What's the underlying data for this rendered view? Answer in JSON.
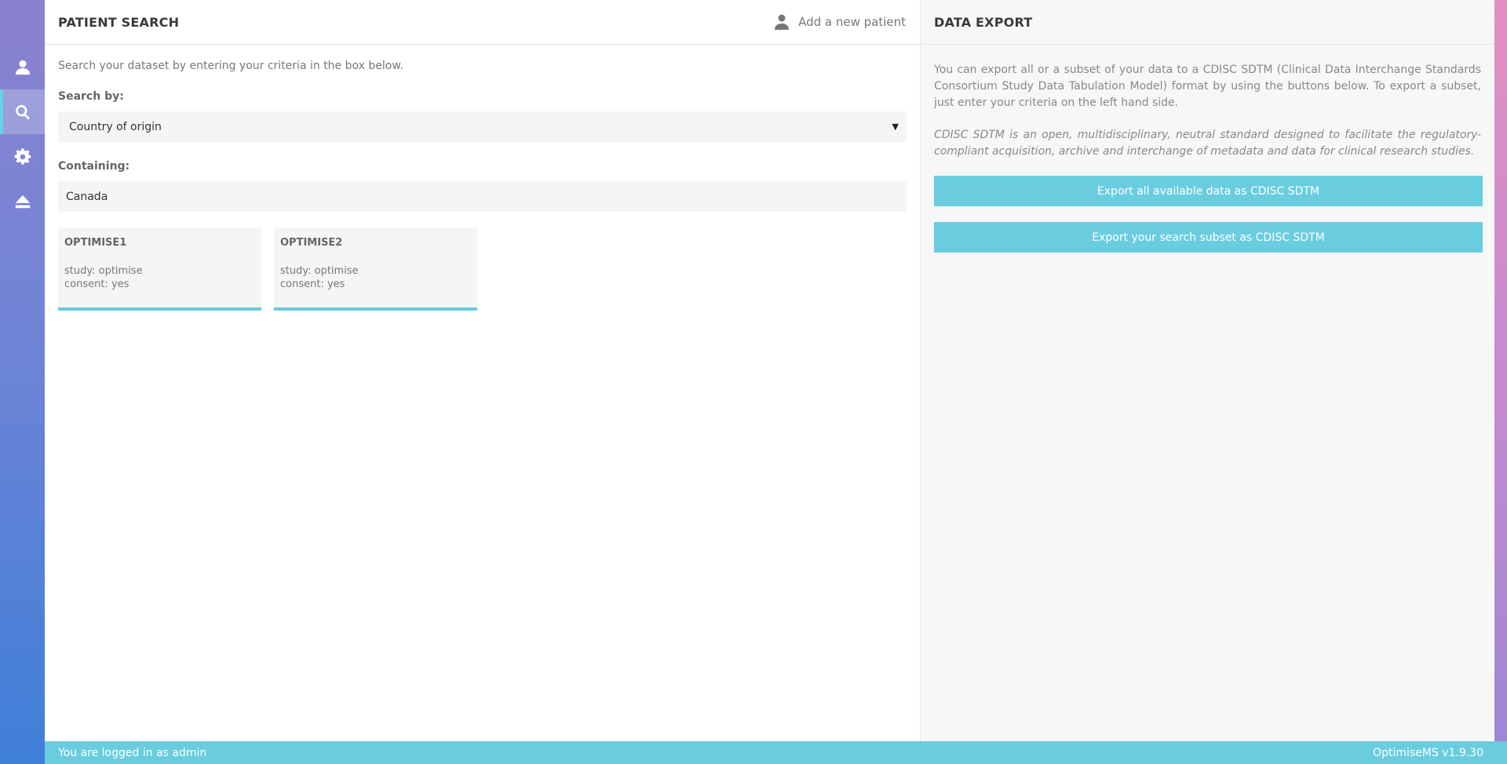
{
  "nav": {
    "items": [
      {
        "icon": "user-icon"
      },
      {
        "icon": "search-icon",
        "active": true
      },
      {
        "icon": "gear-icon"
      },
      {
        "icon": "eject-icon"
      }
    ]
  },
  "patient_search": {
    "title": "PATIENT SEARCH",
    "add_patient_label": "Add a new patient",
    "intro": "Search your dataset by entering your criteria in the box below.",
    "search_by_label": "Search by:",
    "search_by_value": "Country of origin",
    "containing_label": "Containing:",
    "containing_value": "Canada",
    "results": [
      {
        "id": "OPTIMISE1",
        "study": "study: optimise",
        "consent": "consent: yes"
      },
      {
        "id": "OPTIMISE2",
        "study": "study: optimise",
        "consent": "consent: yes"
      }
    ]
  },
  "data_export": {
    "title": "DATA EXPORT",
    "description": "You can export all or a subset of your data to a CDISC SDTM (Clinical Data Interchange Standards Consortium Study Data Tabulation Model) format by using the buttons below. To export a subset, just enter your criteria on the left hand side.",
    "note": "CDISC SDTM is an open, multidisciplinary, neutral standard designed to facilitate the regulatory-compliant acquisition, archive and interchange of metadata and data for clinical research studies.",
    "export_all_label": "Export all available data as CDISC SDTM",
    "export_subset_label": "Export your search subset as CDISC SDTM"
  },
  "footer": {
    "login_status": "You are logged in as admin",
    "version": "OptimiseMS v1.9.30"
  },
  "colors": {
    "accent": "#69cddf",
    "nav_top": "#8b82cf",
    "nav_bottom": "#3f7fd8"
  }
}
